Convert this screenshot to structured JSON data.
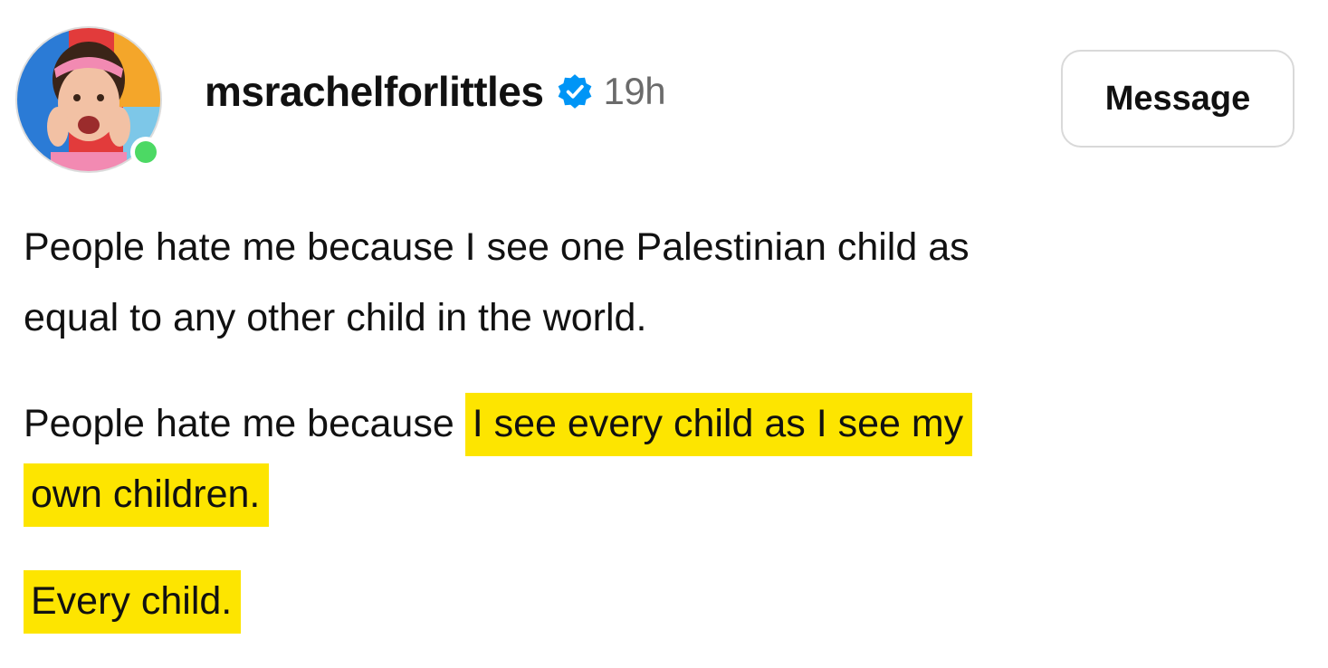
{
  "post": {
    "username": "msrachelforlittles",
    "verified_icon": "verified-badge-icon",
    "time_ago": "19h",
    "message_button_label": "Message",
    "avatar_status": "online",
    "colors": {
      "verified_blue": "#0095f6",
      "online_green": "#4cd964",
      "highlight_yellow": "#fde500",
      "time_gray": "#6b6b6b"
    }
  },
  "body": {
    "p1_line1": "People hate me because I see one Palestinian child as",
    "p1_line2": "equal to any other child in the world.",
    "p2_plain": "People hate me because ",
    "p2_highlight1": "I see every child as I see my",
    "p2_highlight2": "own children.",
    "p3_highlight": "Every child."
  }
}
